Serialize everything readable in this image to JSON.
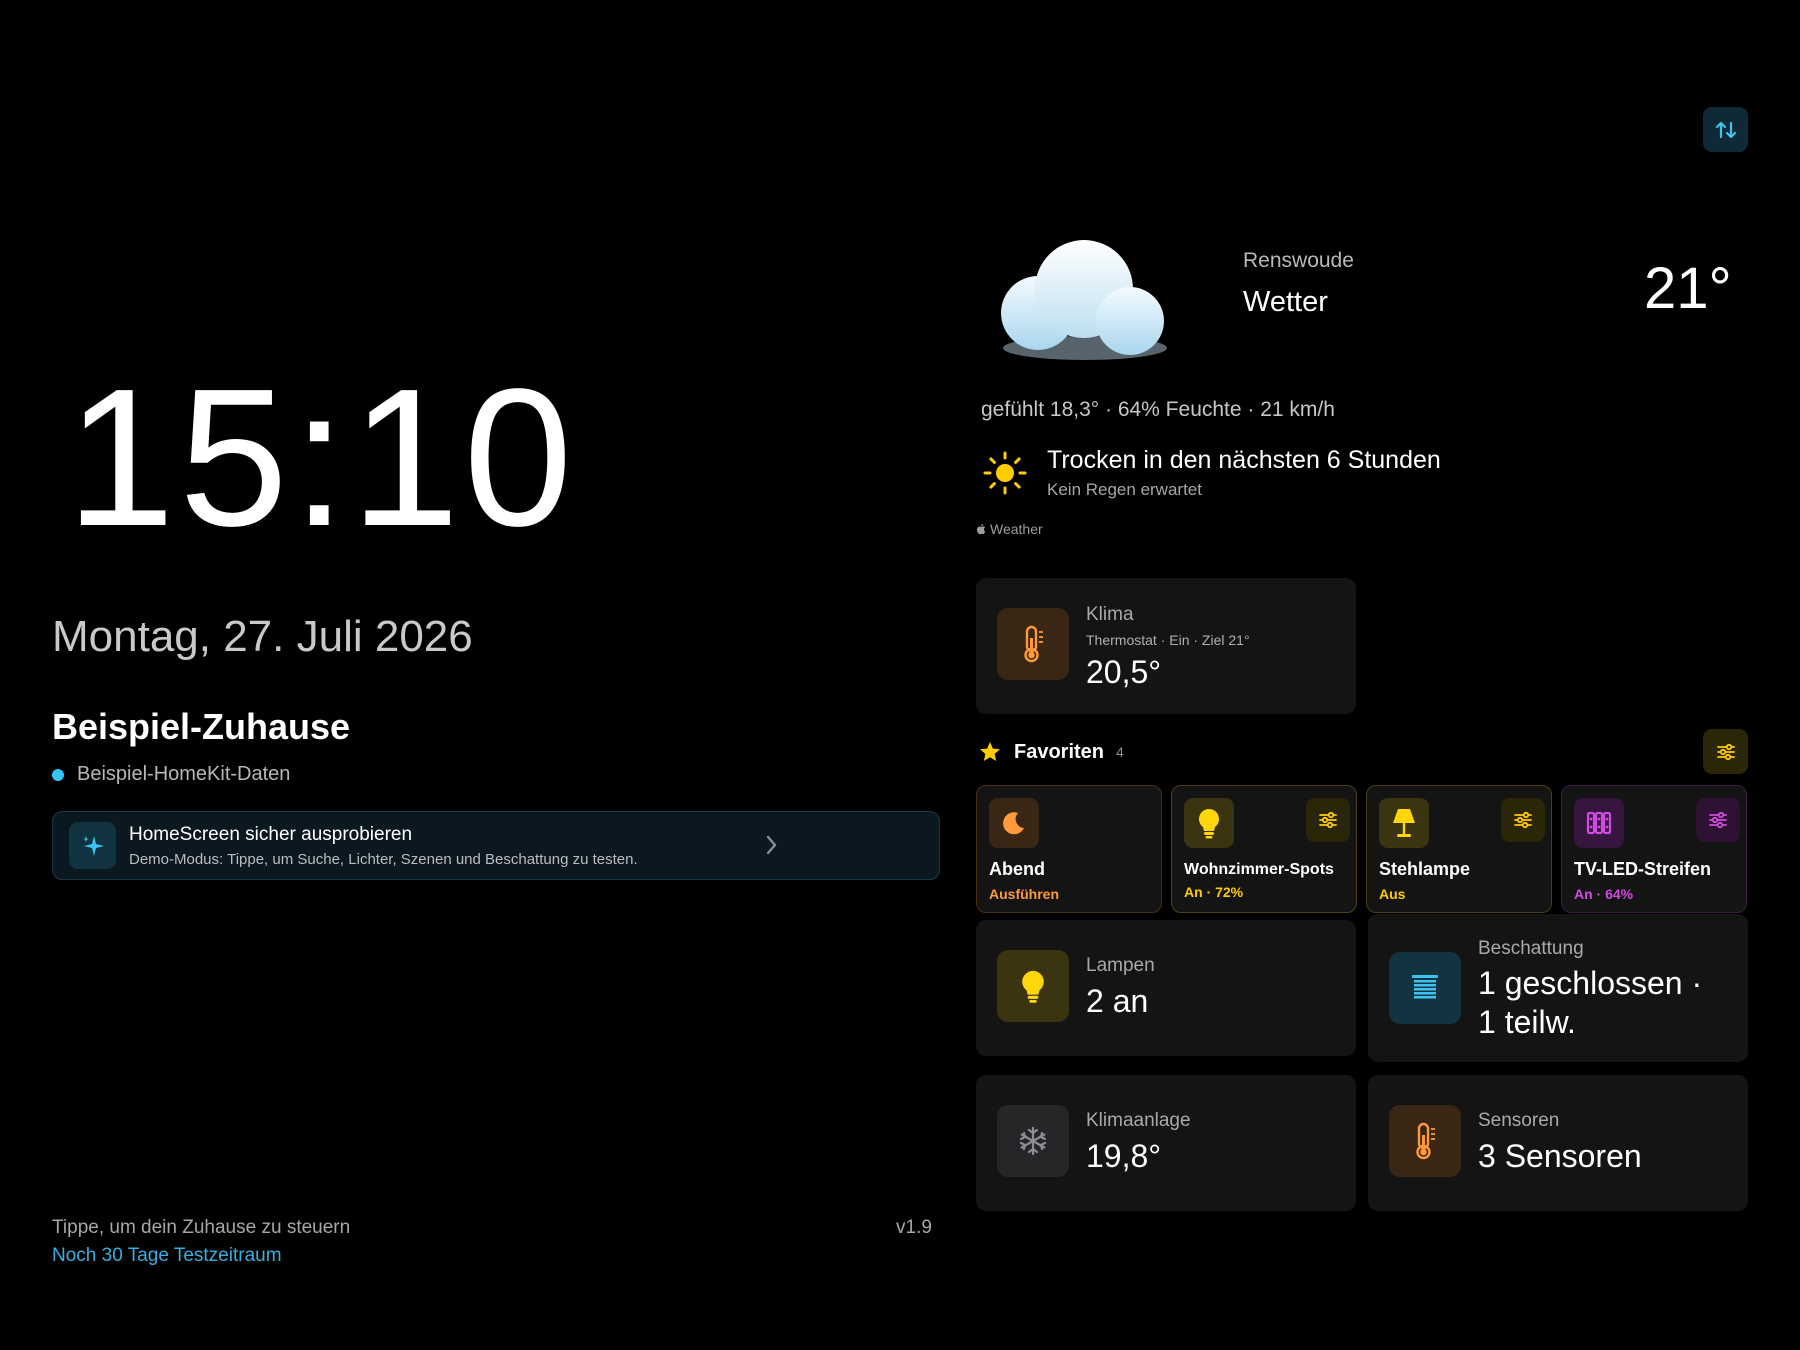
{
  "clock": {
    "time": "15:10",
    "date": "Montag, 27. Juli 2026"
  },
  "home": {
    "title": "Beispiel-Zuhause",
    "subtitle": "Beispiel-HomeKit-Daten"
  },
  "demo_banner": {
    "title": "HomeScreen sicher ausprobieren",
    "description": "Demo-Modus: Tippe, um Suche, Lichter, Szenen und Beschattung zu testen.",
    "icon": "sparkles-icon"
  },
  "footer": {
    "hint": "Tippe, um dein Zuhause zu steuern",
    "trial": "Noch 30 Tage Testzeitraum",
    "version": "v1.9"
  },
  "weather": {
    "location": "Renswoude",
    "title": "Wetter",
    "temperature": "21°",
    "details": "gefühlt 18,3° · 64% Feuchte · 21 km/h",
    "forecast_title": "Trocken in den nächsten 6 Stunden",
    "forecast_sub": "Kein Regen erwartet",
    "attribution": "Weather"
  },
  "climate": {
    "label": "Klima",
    "detail": "Thermostat · Ein · Ziel 21°",
    "value": "20,5°"
  },
  "favorites": {
    "title": "Favoriten",
    "count": "4",
    "items": [
      {
        "name": "Abend",
        "status": "Ausführen",
        "icon": "moon-icon"
      },
      {
        "name": "Wohnzimmer-Spots",
        "status": "An · 72%",
        "icon": "bulb-icon"
      },
      {
        "name": "Stehlampe",
        "status": "Aus",
        "icon": "lamp-icon"
      },
      {
        "name": "TV-LED-Streifen",
        "status": "An · 64%",
        "icon": "led-strip-icon"
      }
    ]
  },
  "tiles": {
    "lamps": {
      "label": "Lampen",
      "value": "2 an"
    },
    "shading": {
      "label": "Beschattung",
      "value_line1": "1 geschlossen ·",
      "value_line2": "1 teilw."
    },
    "ac": {
      "label": "Klimaanlage",
      "value": "19,8°"
    },
    "sensors": {
      "label": "Sensoren",
      "value": "3 Sensoren"
    }
  },
  "colors": {
    "accent_cyan": "#35c4f0",
    "orange": "#ff9500",
    "yellow": "#ffcc00",
    "magenta": "#d24be0"
  }
}
